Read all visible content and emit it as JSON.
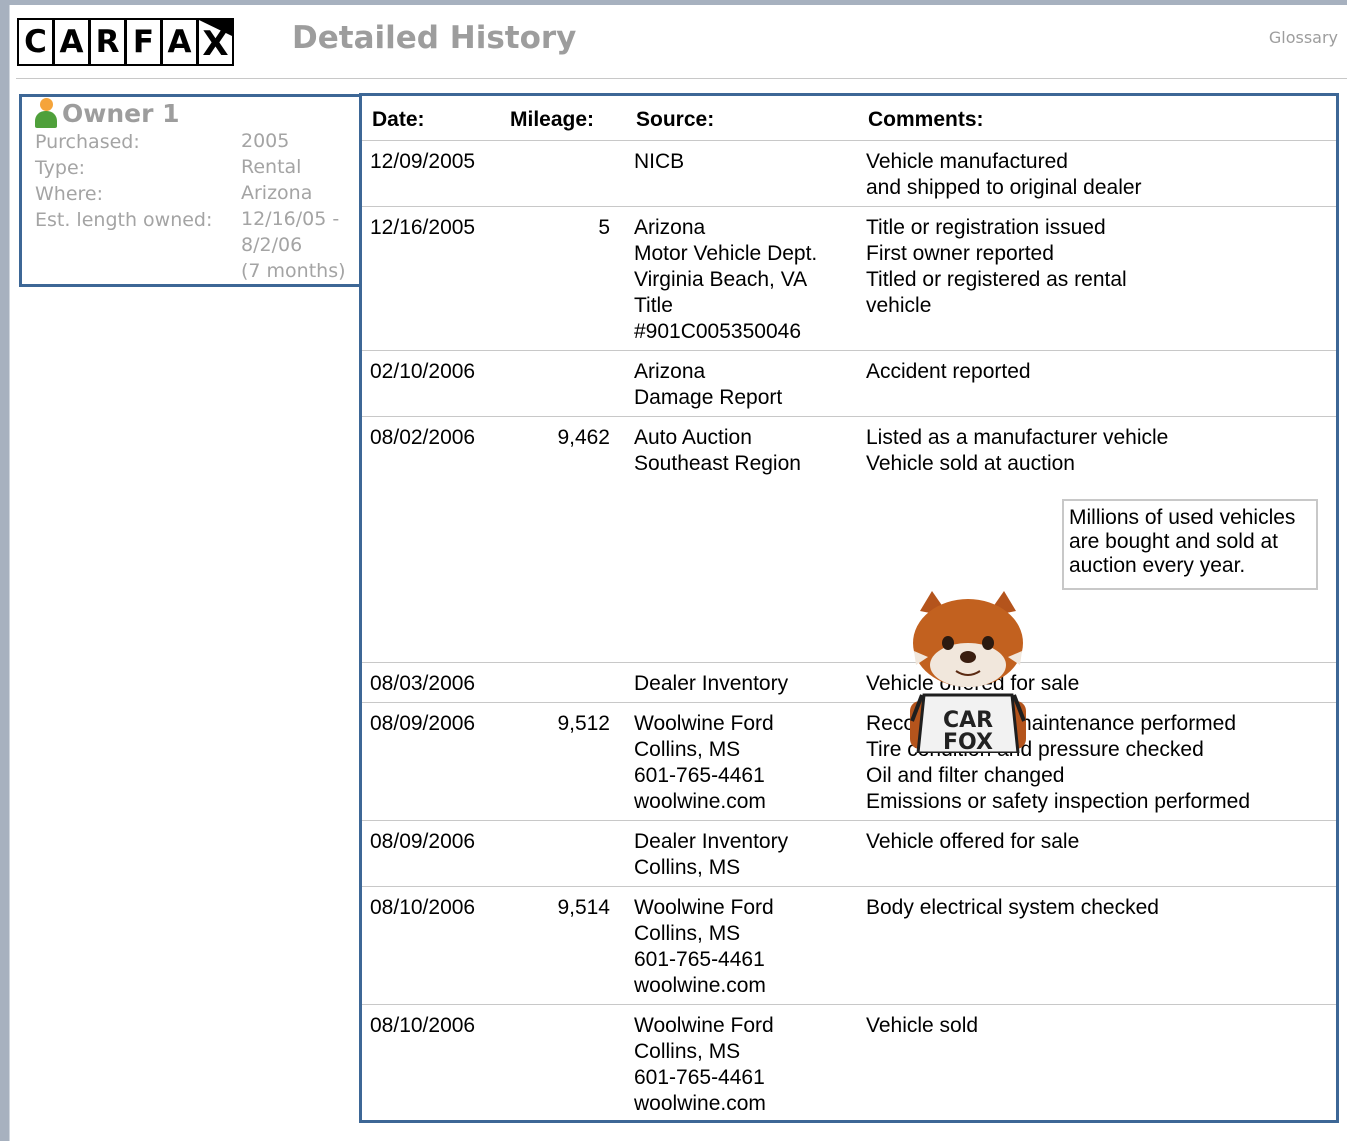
{
  "header": {
    "logo_letters": [
      "C",
      "A",
      "R",
      "F",
      "A",
      "X"
    ],
    "title": "Detailed History",
    "glossary_link": "Glossary"
  },
  "owner": {
    "title": "Owner 1",
    "purchased_label": "Purchased:",
    "purchased_value": "2005",
    "type_label": "Type:",
    "type_value": "Rental",
    "where_label": "Where:",
    "where_value": "Arizona",
    "length_label": "Est. length owned:",
    "length_value": [
      "12/16/05 -",
      "8/2/06",
      "(7 months)"
    ]
  },
  "table": {
    "headers": {
      "date": "Date:",
      "mileage": "Mileage:",
      "source": "Source:",
      "comments": "Comments:"
    },
    "rows": [
      {
        "date": "12/09/2005",
        "mileage": "",
        "source": [
          "NICB"
        ],
        "comments": [
          "Vehicle manufactured",
          "and shipped to original dealer"
        ]
      },
      {
        "date": "12/16/2005",
        "mileage": "5",
        "source": [
          "Arizona",
          "Motor Vehicle Dept.",
          "Virginia Beach, VA",
          "Title",
          "#901C005350046"
        ],
        "comments": [
          "Title or registration issued",
          "First owner reported",
          "Titled or registered as rental",
          "vehicle"
        ]
      },
      {
        "date": "02/10/2006",
        "mileage": "",
        "source": [
          "Arizona",
          "Damage Report"
        ],
        "comments": [
          "Accident reported"
        ]
      },
      {
        "date": "08/02/2006",
        "mileage": "9,462",
        "source": [
          "Auto Auction",
          "Southeast Region"
        ],
        "comments": [
          "Listed as a manufacturer vehicle",
          "Vehicle sold at auction"
        ]
      },
      {
        "date": "08/03/2006",
        "mileage": "",
        "source": [
          "Dealer Inventory"
        ],
        "comments": [
          "Vehicle offered for sale"
        ]
      },
      {
        "date": "08/09/2006",
        "mileage": "9,512",
        "source": [
          "Woolwine Ford",
          "Collins, MS",
          "601-765-4461",
          "woolwine.com"
        ],
        "comments": [
          "Recommended maintenance performed",
          "Tire condition and pressure checked",
          "Oil and filter changed",
          "Emissions or safety inspection performed"
        ]
      },
      {
        "date": "08/09/2006",
        "mileage": "",
        "source": [
          "Dealer Inventory",
          "Collins, MS"
        ],
        "comments": [
          "Vehicle offered for sale"
        ]
      },
      {
        "date": "08/10/2006",
        "mileage": "9,514",
        "source": [
          "Woolwine Ford",
          "Collins, MS",
          "601-765-4461",
          "woolwine.com"
        ],
        "comments": [
          "Body electrical system checked"
        ]
      },
      {
        "date": "08/10/2006",
        "mileage": "",
        "source": [
          "Woolwine Ford",
          "Collins, MS",
          "601-765-4461",
          "woolwine.com"
        ],
        "comments": [
          "Vehicle sold"
        ]
      }
    ]
  },
  "promo": {
    "mascot_shirt_text": [
      "CAR",
      "FOX"
    ],
    "bubble_text": [
      "Millions of used vehicles",
      "are bought and sold at",
      "auction every year."
    ]
  }
}
